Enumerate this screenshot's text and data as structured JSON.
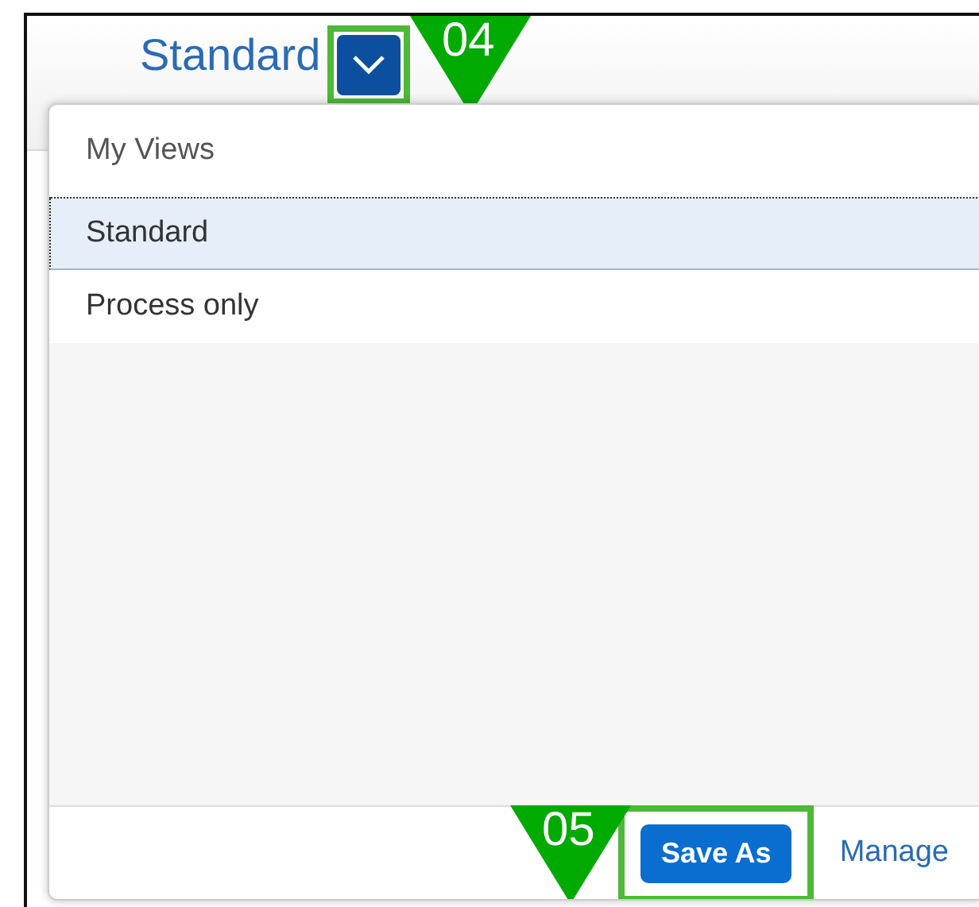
{
  "header": {
    "title": "Standard",
    "dropdown": {
      "expanded": true,
      "callout": "04"
    }
  },
  "popover": {
    "heading": "My Views",
    "items": [
      {
        "label": "Standard",
        "selected": true
      },
      {
        "label": "Process only",
        "selected": false
      }
    ],
    "buttons": [
      {
        "label": "Save As",
        "kind": "primary",
        "callout": "05"
      },
      {
        "label": "Manage",
        "kind": "link"
      }
    ]
  }
}
